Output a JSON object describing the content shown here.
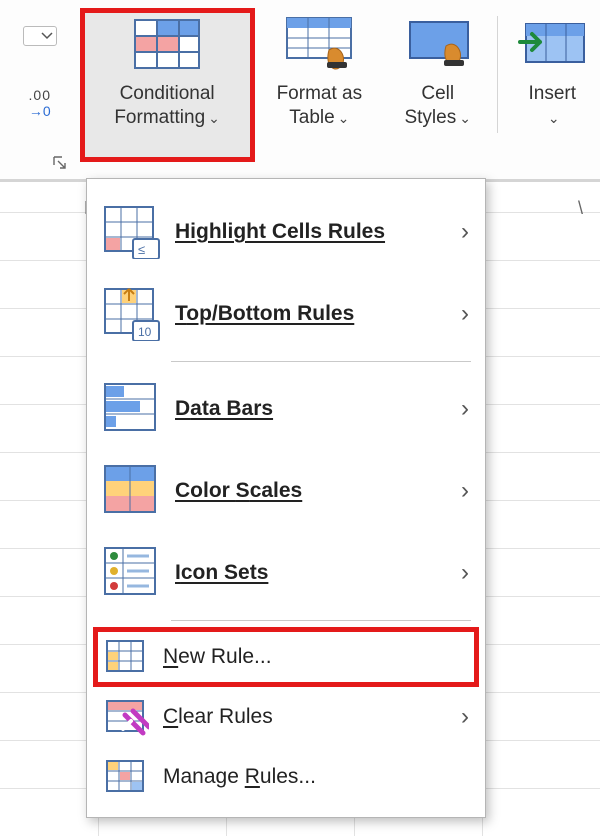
{
  "ribbon": {
    "decrease_decimal_tooltip": ".00",
    "conditional_formatting": "Conditional Formatting",
    "format_as_table": "Format as Table",
    "cell_styles": "Cell Styles",
    "insert": "Insert"
  },
  "menu": {
    "highlight_cells_rules": "Highlight Cells Rules",
    "top_bottom_rules": "Top/Bottom Rules",
    "data_bars": "Data Bars",
    "color_scales": "Color Scales",
    "icon_sets": "Icon Sets",
    "new_rule": "New Rule...",
    "clear_rules": "Clear Rules",
    "manage_rules": "Manage Rules..."
  },
  "grid": {
    "col_f": "F",
    "col_right": "\\"
  }
}
